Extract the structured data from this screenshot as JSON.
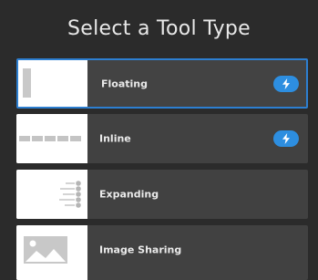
{
  "dialog": {
    "title": "Select a Tool Type"
  },
  "options": [
    {
      "label": "Floating",
      "selected": true,
      "badge_icon": "lightning-bolt-icon"
    },
    {
      "label": "Inline",
      "selected": false,
      "badge_icon": "lightning-bolt-icon"
    },
    {
      "label": "Expanding",
      "selected": false
    },
    {
      "label": "Image Sharing",
      "selected": false
    }
  ],
  "colors": {
    "background": "#2b2b2b",
    "card": "#414141",
    "accent": "#2d7fd1",
    "badge": "#2d8ee0",
    "text": "#eaeaea"
  }
}
